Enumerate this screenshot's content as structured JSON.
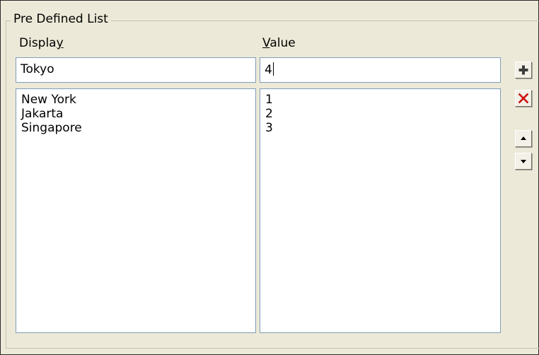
{
  "group": {
    "title": "Pre Defined List"
  },
  "display_column": {
    "label_pre": "Displa",
    "label_accel": "y",
    "label_post": "",
    "input_value": "Tokyo",
    "items": [
      "New York",
      "Jakarta",
      "Singapore"
    ]
  },
  "value_column": {
    "label_pre": "",
    "label_accel": "V",
    "label_post": "alue",
    "input_value": "4",
    "items": [
      "1",
      "2",
      "3"
    ]
  },
  "buttons": {
    "add_icon": "plus-icon",
    "delete_icon": "red-x-icon",
    "move_up_icon": "triangle-up-icon",
    "move_down_icon": "triangle-down-icon"
  },
  "colors": {
    "panel_background": "#ece9d8",
    "field_border": "#7f9db9",
    "delete_red": "#cc1111"
  }
}
